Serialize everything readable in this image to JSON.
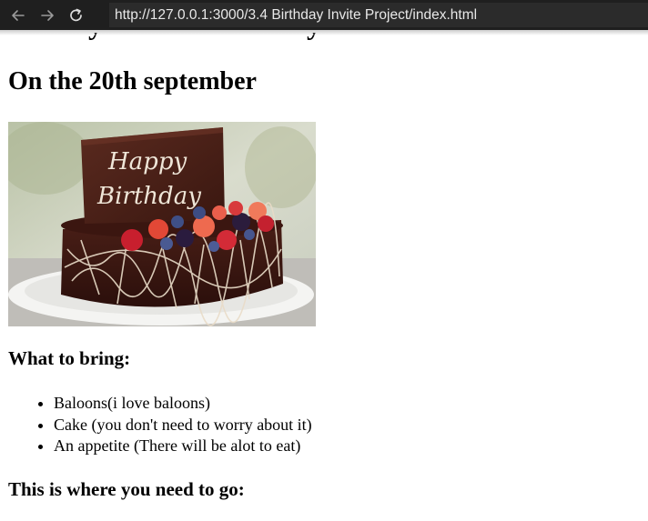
{
  "browser": {
    "url": "http://127.0.0.1:3000/3.4 Birthday Invite Project/index.html",
    "back_icon": "arrow-left",
    "forward_icon": "arrow-right",
    "reload_icon": "reload"
  },
  "content": {
    "date_heading": "On the 20th september",
    "what_to_bring_heading": "What to bring:",
    "bring_items": [
      "Baloons(i love baloons)",
      "Cake (you don't need to worry about it)",
      "An appetite (There will be alot to eat)"
    ],
    "location_heading": "This is where you need to go:",
    "cake_image": {
      "inscription": [
        "Happy",
        "Birthday"
      ]
    }
  }
}
